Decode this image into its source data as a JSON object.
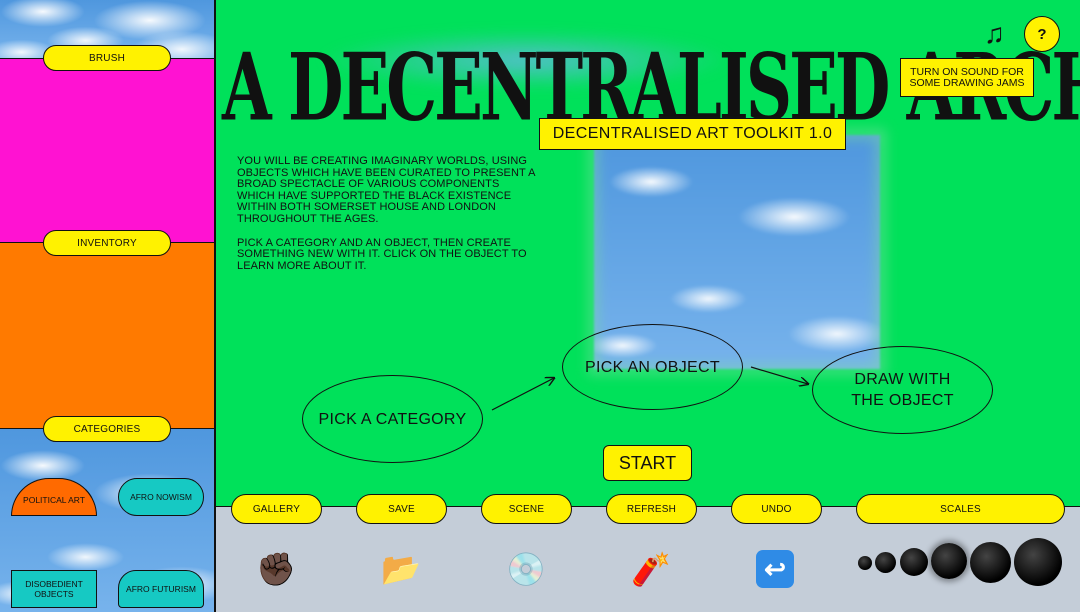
{
  "sidebar": {
    "brush_label": "BRUSH",
    "inventory_label": "INVENTORY",
    "categories_label": "CATEGORIES",
    "categories": [
      {
        "label": "POLITICAL ART"
      },
      {
        "label": "AFRO NOWISM"
      },
      {
        "label": "DISOBEDIENT OBJECTS"
      },
      {
        "label": "AFRO FUTURISM"
      }
    ]
  },
  "header": {
    "title": "A DECENTRALISED ARCHIVE",
    "version": "DECENTRALISED ART TOOLKIT 1.0",
    "help_label": "?",
    "music_icon": "music-note-icon",
    "sound_hint": "TURN ON SOUND FOR SOME DRAWING JAMS"
  },
  "intro": {
    "paragraph1": "YOU WILL BE CREATING IMAGINARY WORLDS, USING OBJECTS WHICH HAVE BEEN CURATED TO PRESENT A BROAD SPECTACLE OF VARIOUS COMPONENTS WHICH HAVE SUPPORTED THE BLACK EXISTENCE WITHIN BOTH SOMERSET HOUSE AND LONDON THROUGHOUT THE AGES.",
    "paragraph2": "PICK A CATEGORY AND AN OBJECT, THEN CREATE SOMETHING NEW WITH IT. CLICK ON THE OBJECT TO LEARN MORE ABOUT IT."
  },
  "steps": {
    "step1": "PICK A CATEGORY",
    "step2": "PICK AN OBJECT",
    "step3": "DRAW WITH THE OBJECT"
  },
  "start_label": "START",
  "toolbar": {
    "gallery": "GALLERY",
    "save": "SAVE",
    "scene": "SCENE",
    "refresh": "REFRESH",
    "undo": "UNDO",
    "scales": "SCALES",
    "icons": {
      "gallery": "fist-icon",
      "save": "folder-icon",
      "scene": "disc-icon",
      "refresh": "dynamite-icon",
      "undo": "return-arrow-icon"
    },
    "icon_glyphs": {
      "gallery": "✊🏿",
      "save": "📂",
      "scene": "💿",
      "refresh": "🧨",
      "undo": "↩"
    }
  },
  "colors": {
    "accent_yellow": "#fff200",
    "main_green": "#00e15a",
    "brush_magenta": "#ff12d2",
    "inventory_orange": "#ff7a00",
    "category_teal": "#16c9c3",
    "toolbar_grey": "#c4cdd8"
  }
}
